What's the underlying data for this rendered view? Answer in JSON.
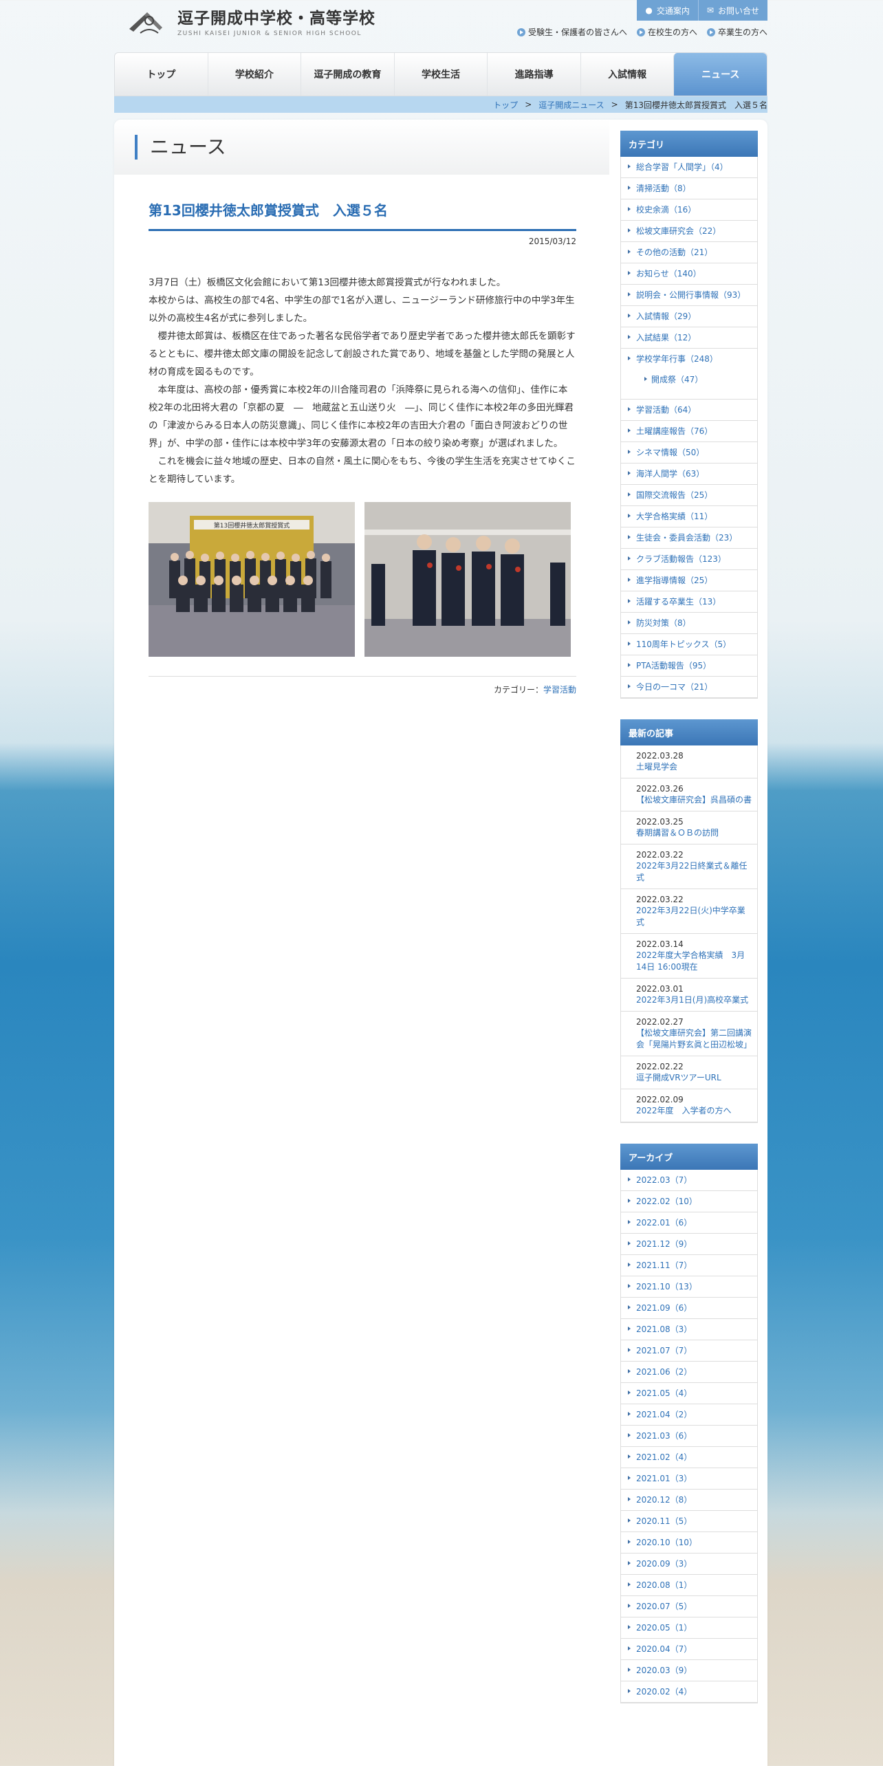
{
  "header": {
    "school_name": "逗子開成中学校・高等学校",
    "school_name_en": "ZUSHI KAISEI JUNIOR & SENIOR HIGH SCHOOL",
    "util": [
      "交通案内",
      "お問い合せ"
    ],
    "audience": [
      "受験生・保護者の皆さんへ",
      "在校生の方へ",
      "卒業生の方へ"
    ]
  },
  "nav": [
    "トップ",
    "学校紹介",
    "逗子開成の教育",
    "学校生活",
    "進路指導",
    "入試情報",
    "ニュース"
  ],
  "breadcrumb": [
    "トップ",
    "逗子開成ニュース",
    "第13回櫻井徳太郎賞授賞式　入選５名"
  ],
  "page_title": "ニュース",
  "article": {
    "title": "第13回櫻井徳太郎賞授賞式　入選５名",
    "date": "2015/03/12",
    "paragraphs": [
      "3月7日（土）板橋区文化会館において第13回櫻井徳太郎賞授賞式が行なわれました。",
      "本校からは、高校生の部で4名、中学生の部で1名が入選し、ニュージーランド研修旅行中の中学3年生以外の高校生4名が式に参列しました。",
      "　櫻井徳太郎賞は、板橋区在住であった著名な民俗学者であり歴史学者であった櫻井徳太郎氏を顕彰するとともに、櫻井徳太郎文庫の開設を記念して創設された賞であり、地域を基盤とした学問の発展と人材の育成を図るものです。",
      "　本年度は、高校の部・優秀賞に本校2年の川合隆司君の「浜降祭に見られる海への信仰」、佳作に本校2年の北田将大君の「京都の夏　―　地蔵盆と五山送り火　―」、同じく佳作に本校2年の多田光輝君の「津波からみる日本人の防災意識」、同じく佳作に本校2年の吉田大介君の「面白き阿波おどりの世界」が、中学の部・佳作には本校中学3年の安藤源太君の「日本の絞り染め考察」が選ばれました。",
      "　これを機会に益々地域の歴史、日本の自然・風土に関心をもち、今後の学生生活を充実させてゆくことを期待しています。"
    ],
    "photo_banner": "第13回櫻井徳太郎賞授賞式",
    "category_label": "カテゴリー：",
    "category": "学習活動"
  },
  "sidebar": {
    "categories_title": "カテゴリ",
    "categories": [
      "総合学習「人間学」（4）",
      "清掃活動（8）",
      "校史余滴（16）",
      "松坡文庫研究会（22）",
      "その他の活動（21）",
      "お知らせ（140）",
      "説明会・公開行事情報（93）",
      "入試情報（29）",
      "入試結果（12）",
      "学校学年行事（248）",
      "開成祭（47）",
      "学習活動（64）",
      "土曜講座報告（76）",
      "シネマ情報（50）",
      "海洋人間学（63）",
      "国際交流報告（25）",
      "大学合格実績（11）",
      "生徒会・委員会活動（23）",
      "クラブ活動報告（123）",
      "進学指導情報（25）",
      "活躍する卒業生（13）",
      "防災対策（8）",
      "110周年トピックス（5）",
      "PTA活動報告（95）",
      "今日の一コマ（21）"
    ],
    "recent_title": "最新の記事",
    "recent": [
      {
        "date": "2022.03.28",
        "title": "土曜見学会"
      },
      {
        "date": "2022.03.26",
        "title": "【松坡文庫研究会】呉昌碩の書"
      },
      {
        "date": "2022.03.25",
        "title": "春期講習＆ＯＢの訪問"
      },
      {
        "date": "2022.03.22",
        "title": "2022年3月22日終業式＆離任式"
      },
      {
        "date": "2022.03.22",
        "title": "2022年3月22日(火)中学卒業式"
      },
      {
        "date": "2022.03.14",
        "title": "2022年度大学合格実績　3月14日 16:00現在"
      },
      {
        "date": "2022.03.01",
        "title": "2022年3月1日(月)高校卒業式"
      },
      {
        "date": "2022.02.27",
        "title": "【松坡文庫研究会】第二回講演会「晃陽片野玄眞と田辺松坡」"
      },
      {
        "date": "2022.02.22",
        "title": "逗子開成VRツアーURL"
      },
      {
        "date": "2022.02.09",
        "title": "2022年度　入学者の方へ"
      }
    ],
    "archive_title": "アーカイブ",
    "archive": [
      "2022.03（7）",
      "2022.02（10）",
      "2022.01（6）",
      "2021.12（9）",
      "2021.11（7）",
      "2021.10（13）",
      "2021.09（6）",
      "2021.08（3）",
      "2021.07（7）",
      "2021.06（2）",
      "2021.05（4）",
      "2021.04（2）",
      "2021.03（6）",
      "2021.02（4）",
      "2021.01（3）",
      "2020.12（8）",
      "2020.11（5）",
      "2020.10（10）",
      "2020.09（3）",
      "2020.08（1）",
      "2020.07（5）",
      "2020.05（1）",
      "2020.04（7）",
      "2020.03（9）",
      "2020.02（4）"
    ]
  }
}
